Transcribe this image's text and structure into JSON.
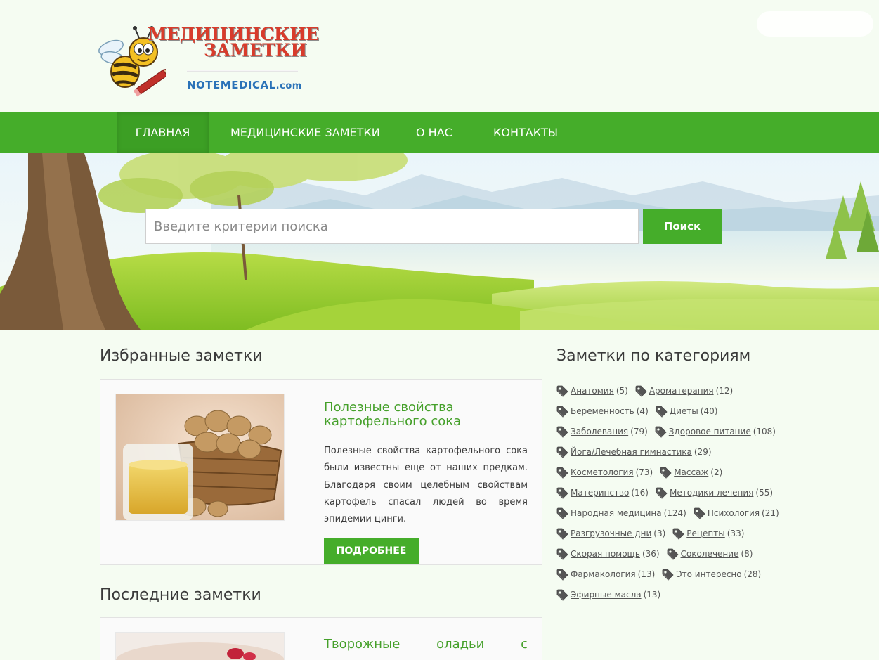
{
  "header": {
    "logo_title_line1": "МЕДИЦИНСКИЕ",
    "logo_title_line2": "ЗАМЕТКИ",
    "logo_site_main": "NOTEMEDICAL",
    "logo_site_tld": ".com"
  },
  "nav": {
    "items": [
      {
        "label": "ГЛАВНАЯ",
        "active": true
      },
      {
        "label": "МЕДИЦИНСКИЕ ЗАМЕТКИ",
        "active": false
      },
      {
        "label": "О НАС",
        "active": false
      },
      {
        "label": "КОНТАКТЫ",
        "active": false
      }
    ]
  },
  "search": {
    "placeholder": "Введите критерии поиска",
    "value": "",
    "button_label": "Поиск"
  },
  "featured": {
    "section_title": "Избранные заметки",
    "card": {
      "title": "Полезные свойства картофельного сока",
      "text": "Полезные свойства картофельного сока были известны еще от наших предкам. Благодаря своим целебным свойствам картофель спасал людей во время эпидемии цинги.",
      "button_label": "ПОДРОБНЕЕ"
    }
  },
  "latest": {
    "section_title": "Последние заметки",
    "card": {
      "title": "Творожные оладьи с"
    }
  },
  "categories": {
    "section_title": "Заметки по категориям",
    "rows": [
      [
        {
          "name": "Анатомия",
          "count": "(5)"
        },
        {
          "name": "Ароматерапия",
          "count": "(12)"
        }
      ],
      [
        {
          "name": "Беременность",
          "count": "(4)"
        },
        {
          "name": "Диеты",
          "count": "(40)"
        }
      ],
      [
        {
          "name": "Заболевания",
          "count": "(79)"
        },
        {
          "name": "Здоровое питание",
          "count": "(108)"
        }
      ],
      [
        {
          "name": "Йога/Лечебная гимнастика",
          "count": "(29)"
        }
      ],
      [
        {
          "name": "Косметология",
          "count": "(73)"
        },
        {
          "name": "Массаж",
          "count": "(2)"
        }
      ],
      [
        {
          "name": "Материнство",
          "count": "(16)"
        },
        {
          "name": "Методики лечения",
          "count": "(55)"
        }
      ],
      [
        {
          "name": "Народная медицина",
          "count": "(124)"
        },
        {
          "name": "Психология",
          "count": "(21)"
        }
      ],
      [
        {
          "name": "Разгрузочные дни",
          "count": "(3)"
        },
        {
          "name": "Рецепты",
          "count": "(33)"
        }
      ],
      [
        {
          "name": "Скорая помощь",
          "count": "(36)"
        },
        {
          "name": "Соколечение",
          "count": "(8)"
        }
      ],
      [
        {
          "name": "Фармакология",
          "count": "(13)"
        },
        {
          "name": "Это интересно",
          "count": "(28)"
        }
      ],
      [
        {
          "name": "Эфирные масла",
          "count": "(13)"
        }
      ]
    ]
  },
  "colors": {
    "accent_green": "#45ad2a",
    "title_red": "#d83b2b",
    "link_blue": "#2a72b8",
    "page_bg": "#f5fcf2"
  },
  "icons": {
    "category": "tag-icon",
    "logo": "bee-pencil-logo"
  }
}
